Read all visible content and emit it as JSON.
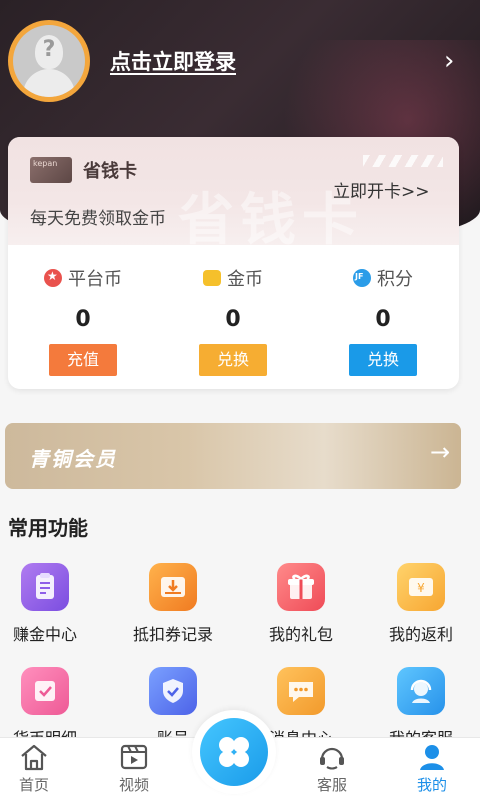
{
  "header": {
    "login_text": "点击立即登录",
    "arrow": "›"
  },
  "card": {
    "icon_text": "kepan",
    "title": "省钱卡",
    "open_text": "立即开卡>>",
    "subtitle": "每天免费领取金币",
    "watermark": "省钱卡",
    "stats": [
      {
        "label": "平台币",
        "value": "0",
        "button": "充值",
        "icon": "star-coin-icon"
      },
      {
        "label": "金币",
        "value": "0",
        "button": "兑换",
        "icon": "gold-coin-icon"
      },
      {
        "label": "积分",
        "value": "0",
        "button": "兑换",
        "icon": "points-icon"
      }
    ]
  },
  "bronze": {
    "label": "青铜会员",
    "arrow": "→"
  },
  "functions": {
    "title": "常用功能",
    "items": [
      {
        "label": "赚金中心",
        "icon": "clipboard-icon",
        "color": "#8f5ee8"
      },
      {
        "label": "抵扣券记录",
        "icon": "coupon-download-icon",
        "color": "#f38a2a"
      },
      {
        "label": "我的礼包",
        "icon": "gift-icon",
        "color": "#f05d63"
      },
      {
        "label": "我的返利",
        "icon": "rebate-ticket-icon",
        "color": "#f6ad38"
      },
      {
        "label": "货币明细",
        "icon": "currency-detail-icon",
        "color": "#f06aa2"
      },
      {
        "label": "账号",
        "icon": "shield-check-icon",
        "color": "#5a71ec"
      },
      {
        "label": "消息中心",
        "icon": "message-icon",
        "color": "#f4a63a"
      },
      {
        "label": "我的客服",
        "icon": "customer-service-icon",
        "color": "#3aa2f0"
      }
    ]
  },
  "tabbar": {
    "items": [
      {
        "label": "首页",
        "icon": "home-icon",
        "active": false
      },
      {
        "label": "视频",
        "icon": "video-icon",
        "active": false
      },
      {
        "label": "客服",
        "icon": "headset-icon",
        "active": false
      },
      {
        "label": "我的",
        "icon": "user-icon",
        "active": true
      }
    ],
    "active_color": "#1c8fe8"
  }
}
